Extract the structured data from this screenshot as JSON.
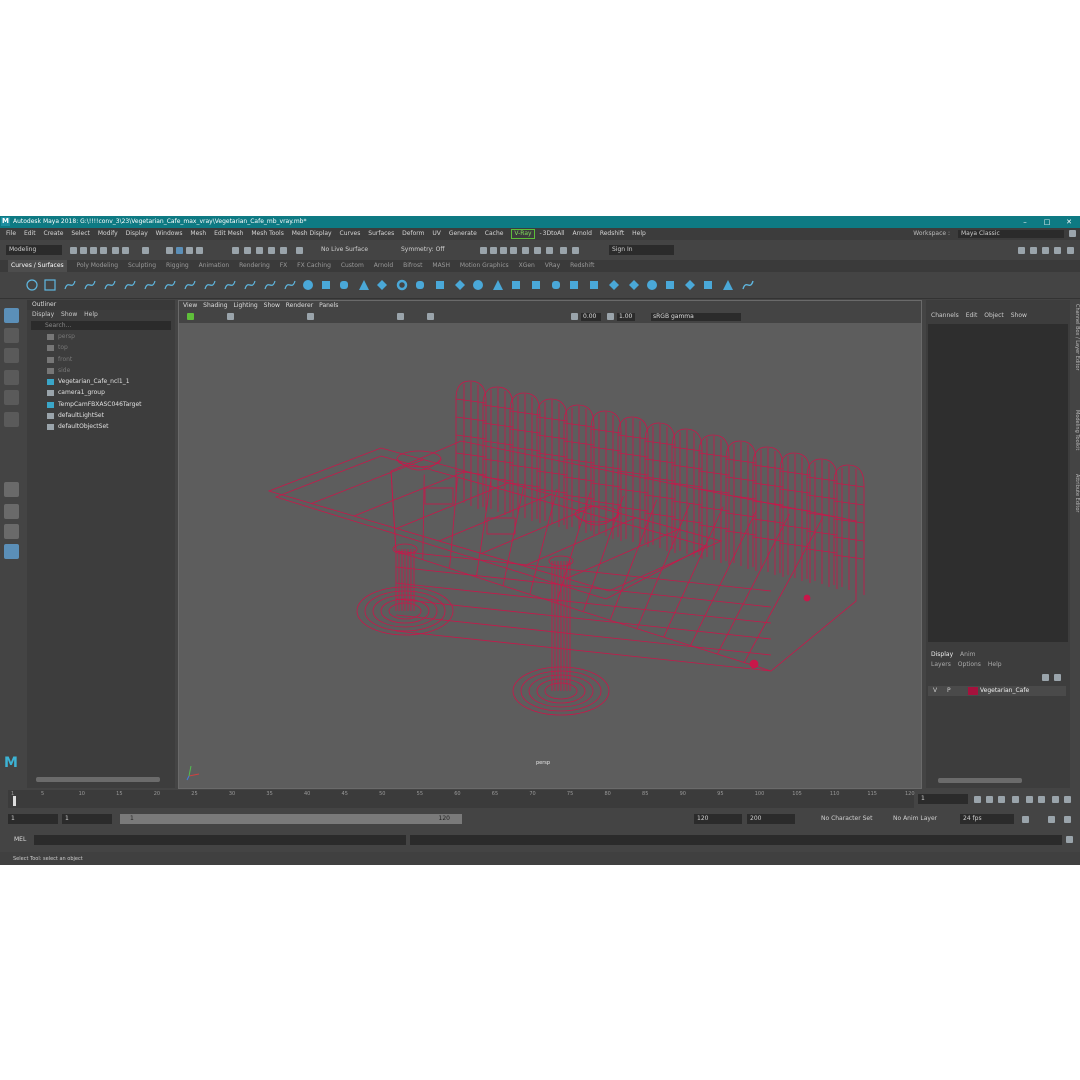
{
  "title": "Autodesk Maya 2018: G:\\!!!!conv_3\\23\\Vegetarian_Cafe_max_vray\\Vegetarian_Cafe_mb_vray.mb*",
  "window_buttons": {
    "minimize": "–",
    "maximize": "□",
    "close": "✕"
  },
  "menu": [
    "File",
    "Edit",
    "Create",
    "Select",
    "Modify",
    "Display",
    "Windows",
    "Mesh",
    "Edit Mesh",
    "Mesh Tools",
    "Mesh Display",
    "Curves",
    "Surfaces",
    "Deform",
    "UV",
    "Generate",
    "Cache",
    "V-Ray",
    "3DtoAll",
    "Arnold",
    "Redshift",
    "Help"
  ],
  "menu_separator": "-",
  "workspace": {
    "label": "Workspace :",
    "value": "Maya Classic"
  },
  "status": {
    "mode": "Modeling",
    "live_surface": "No Live Surface",
    "symmetry": "Symmetry: Off",
    "sign_in": "Sign In"
  },
  "shelf_tabs": [
    "Curves / Surfaces",
    "Poly Modeling",
    "Sculpting",
    "Rigging",
    "Animation",
    "Rendering",
    "FX",
    "FX Caching",
    "Custom",
    "Arnold",
    "Bifrost",
    "MASH",
    "Motion Graphics",
    "XGen",
    "VRay",
    "Redshift"
  ],
  "outliner": {
    "title": "Outliner",
    "menu": [
      "Display",
      "Show",
      "Help"
    ],
    "search_placeholder": "Search...",
    "items": [
      {
        "label": "persp",
        "dim": true
      },
      {
        "label": "top",
        "dim": true
      },
      {
        "label": "front",
        "dim": true
      },
      {
        "label": "side",
        "dim": true
      },
      {
        "label": "Vegetarian_Cafe_ncl1_1",
        "dim": false
      },
      {
        "label": "camera1_group",
        "dim": false
      },
      {
        "label": "TempCamFBXASC046Target",
        "dim": false
      },
      {
        "label": "defaultLightSet",
        "dim": false
      },
      {
        "label": "defaultObjectSet",
        "dim": false
      }
    ]
  },
  "viewport": {
    "menu": [
      "View",
      "Shading",
      "Lighting",
      "Show",
      "Renderer",
      "Panels"
    ],
    "near": "0.00",
    "far": "1.00",
    "color_space": "sRGB gamma",
    "camera_label": "persp",
    "wire_color": "#c8174a"
  },
  "channel_box": {
    "menu": [
      "Channels",
      "Edit",
      "Object",
      "Show"
    ]
  },
  "layer_editor": {
    "tabs": [
      "Display",
      "Anim"
    ],
    "menu": [
      "Layers",
      "Options",
      "Help"
    ],
    "layer": {
      "v": "V",
      "p": "P",
      "name": "Vegetarian_Cafe",
      "color": "#a5123d"
    }
  },
  "side_tabs": [
    "Channel Box / Layer Editor",
    "Modeling Toolkit",
    "Attribute Editor"
  ],
  "timeline": {
    "ticks": [
      "1",
      "5",
      "10",
      "15",
      "20",
      "25",
      "30",
      "35",
      "40",
      "45",
      "50",
      "55",
      "60",
      "65",
      "70",
      "75",
      "80",
      "85",
      "90",
      "95",
      "100",
      "105",
      "110",
      "115",
      "120"
    ],
    "current": "1"
  },
  "range": {
    "start": "1",
    "playback_start": "1",
    "slider_start": "1",
    "slider_end": "120",
    "playback_end": "120",
    "end": "200",
    "character_set": "No Character Set",
    "anim_layer": "No Anim Layer",
    "fps": "24 fps"
  },
  "command": {
    "lang": "MEL"
  },
  "help_line": "Select Tool: select an object"
}
